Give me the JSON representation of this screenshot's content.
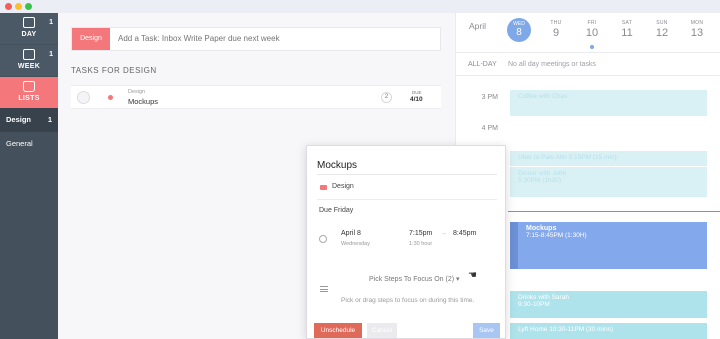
{
  "sidebar": {
    "nav": [
      {
        "label": "DAY",
        "count": "1"
      },
      {
        "label": "WEEK",
        "count": "1"
      },
      {
        "label": "LISTS",
        "count": ""
      }
    ],
    "lists": [
      {
        "label": "Design",
        "count": "1"
      },
      {
        "label": "General",
        "count": ""
      }
    ]
  },
  "main": {
    "list_tag": "Design",
    "add_placeholder": "Add a Task: Inbox Write Paper due next week",
    "section_title": "TASKS FOR DESIGN",
    "tasks": [
      {
        "category": "Design",
        "name": "Mockups",
        "steps": "2",
        "due_label": "DUE",
        "due": "4/10"
      }
    ]
  },
  "calendar": {
    "month": "April",
    "days": [
      {
        "name": "WED",
        "date": "8",
        "today": true
      },
      {
        "name": "THU",
        "date": "9"
      },
      {
        "name": "FRI",
        "date": "10"
      },
      {
        "name": "SAT",
        "date": "11"
      },
      {
        "name": "SUN",
        "date": "12"
      },
      {
        "name": "MON",
        "date": "13"
      }
    ],
    "allday_label": "ALL-DAY",
    "allday_text": "No all day meetings or tasks",
    "hours": [
      "3 PM",
      "4 PM"
    ],
    "events": [
      {
        "title": "Coffee with Chas"
      },
      {
        "title": "Uber to Palo Alto",
        "time": "5:15PM (15 min)"
      },
      {
        "title": "Dinner with John",
        "time": "5:30PM (1h30)"
      },
      {
        "title": "Mockups",
        "time": "7:15-8:45PM (1:30H)"
      },
      {
        "title": "Drinks with Sarah",
        "time": "9:30-10PM"
      },
      {
        "title": "Lyft Home",
        "time": "10:30-11PM (30 mins)"
      }
    ]
  },
  "popup": {
    "title": "Mockups",
    "list": "Design",
    "due": "Due Friday",
    "date": "April 8",
    "weekday": "Wednesday",
    "start": "7:15pm",
    "arrow": "→",
    "end": "8:45pm",
    "duration": "1:30 hour",
    "pick_steps": "Pick Steps To Focus On (2) ▾",
    "hint": "Pick or drag steps to focus on during this time.",
    "unschedule": "Unschedule",
    "cancel": "Cancel",
    "save": "Save"
  },
  "colors": {
    "accent": "#f3777b",
    "sidebar": "#44505c",
    "calendar_blue": "#83a8ec",
    "event_teal": "#aee3ec"
  }
}
